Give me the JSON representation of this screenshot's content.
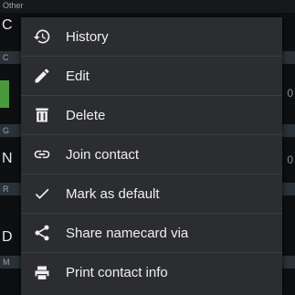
{
  "background": {
    "header_label": "Other",
    "rows": [
      {
        "section": "C",
        "value": "C"
      },
      {
        "section": "G",
        "value": "N"
      },
      {
        "section": "R",
        "value": "D"
      },
      {
        "section": "M",
        "value": ""
      }
    ],
    "first_row_initial": "C",
    "right_marks": [
      "0",
      "0"
    ]
  },
  "menu": {
    "items": [
      {
        "label": "History",
        "icon": "history-icon"
      },
      {
        "label": "Edit",
        "icon": "edit-icon"
      },
      {
        "label": "Delete",
        "icon": "delete-icon"
      },
      {
        "label": "Join contact",
        "icon": "link-icon"
      },
      {
        "label": "Mark as default",
        "icon": "check-icon"
      },
      {
        "label": "Share namecard via",
        "icon": "share-icon"
      },
      {
        "label": "Print contact info",
        "icon": "print-icon"
      }
    ]
  },
  "colors": {
    "menu_bg": "#2c2d30",
    "divider": "#3b3d41",
    "text": "#f0f0f0",
    "accent_green": "#4a9a3c"
  }
}
